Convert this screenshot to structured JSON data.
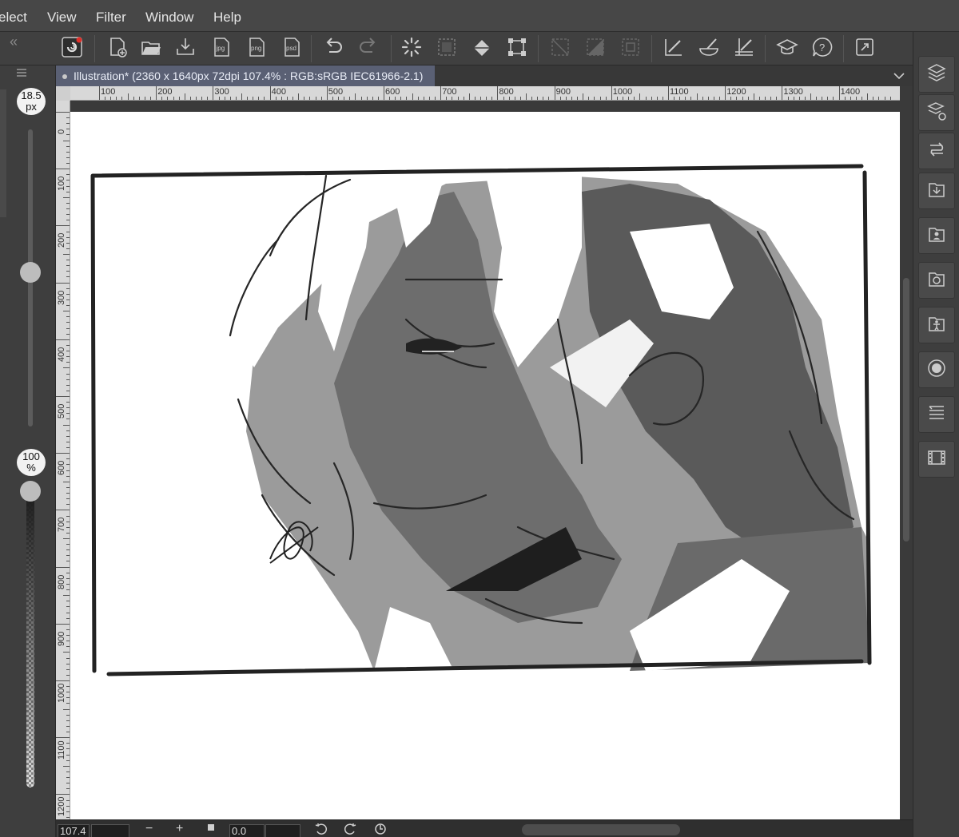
{
  "menu": [
    "elect",
    "View",
    "Filter",
    "Window",
    "Help"
  ],
  "toolbar": {
    "left_collapse": "«",
    "right_collapse": "‹",
    "buttons": [
      {
        "name": "clip-studio-icon"
      },
      {
        "name": "new-file-icon"
      },
      {
        "name": "open-folder-icon"
      },
      {
        "name": "save-icon"
      },
      {
        "name": "export-jpg-icon",
        "text": "jpg"
      },
      {
        "name": "export-png-icon",
        "text": "png"
      },
      {
        "name": "export-psd-icon",
        "text": "psd"
      },
      {
        "name": "undo-icon"
      },
      {
        "name": "redo-icon"
      },
      {
        "name": "loading-icon"
      },
      {
        "name": "select-all-icon"
      },
      {
        "name": "fill-icon"
      },
      {
        "name": "transform-icon"
      },
      {
        "name": "deselect-icon"
      },
      {
        "name": "invert-selection-icon"
      },
      {
        "name": "show-selection-icon"
      },
      {
        "name": "ruler-snap-icon"
      },
      {
        "name": "special-ruler-icon"
      },
      {
        "name": "grid-snap-icon"
      },
      {
        "name": "learn-icon"
      },
      {
        "name": "help-icon"
      },
      {
        "name": "fullscreen-icon"
      }
    ]
  },
  "tab": {
    "title": "Illustration* (2360 x 1640px 72dpi 107.4% : RGB:sRGB IEC61966-2.1)",
    "chevron": "⌄"
  },
  "brush": {
    "size_label": "18.5\npx",
    "size_value": "18.5",
    "size_unit": "px",
    "opacity_value": "100",
    "opacity_unit": "%",
    "size_level": 0.52
  },
  "ruler": {
    "h_labels": [
      "100",
      "200",
      "300",
      "400",
      "500",
      "600",
      "700",
      "800",
      "900",
      "1000",
      "1100",
      "1200",
      "1300",
      "1400"
    ],
    "v_labels": [
      "0",
      "100",
      "200",
      "300",
      "400",
      "500",
      "600",
      "700",
      "800",
      "900",
      "1000",
      "1100",
      "1200"
    ]
  },
  "status": {
    "zoom": "107.4",
    "minus": "−",
    "plus": "+",
    "rotate": "0.0"
  },
  "rightdock": [
    {
      "name": "layer-panel-icon"
    },
    {
      "name": "layer-property-icon"
    },
    {
      "name": "auto-action-icon"
    },
    {
      "name": "import-icon"
    },
    {
      "name": "material-icon"
    },
    {
      "name": "3d-head-icon"
    },
    {
      "name": "figure-icon"
    },
    {
      "name": "color-circle-icon"
    },
    {
      "name": "layer-list-icon"
    },
    {
      "name": "timeline-icon"
    }
  ]
}
